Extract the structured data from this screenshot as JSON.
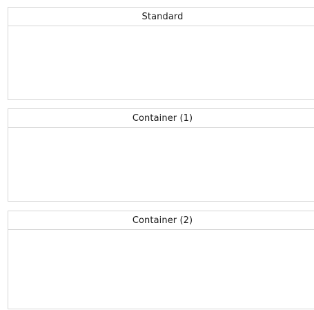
{
  "panels": [
    {
      "title": "Standard"
    },
    {
      "title": "Container (1)"
    },
    {
      "title": "Container (2)"
    }
  ],
  "colors": {
    "border": "#d6d6d6",
    "background": "#ffffff",
    "text": "#1a1a1a"
  }
}
